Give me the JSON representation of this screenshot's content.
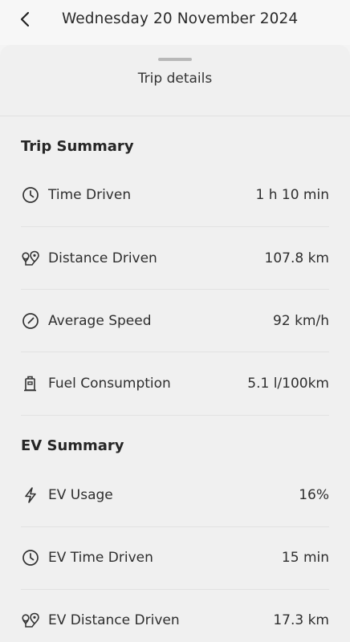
{
  "header": {
    "date": "Wednesday 20 November 2024",
    "back_icon": "chevron-left-icon"
  },
  "sheet": {
    "title": "Trip details"
  },
  "trip_summary": {
    "title": "Trip Summary",
    "rows": [
      {
        "icon": "clock-icon",
        "label": "Time Driven",
        "value": "1 h 10 min"
      },
      {
        "icon": "route-pin-icon",
        "label": "Distance Driven",
        "value": "107.8 km"
      },
      {
        "icon": "speedometer-icon",
        "label": "Average Speed",
        "value": "92 km/h"
      },
      {
        "icon": "fuel-pump-icon",
        "label": "Fuel Consumption",
        "value": "5.1 l/100km"
      }
    ]
  },
  "ev_summary": {
    "title": "EV Summary",
    "rows": [
      {
        "icon": "lightning-icon",
        "label": "EV Usage",
        "value": "16%"
      },
      {
        "icon": "clock-icon",
        "label": "EV Time Driven",
        "value": "15 min"
      },
      {
        "icon": "route-pin-icon",
        "label": "EV Distance Driven",
        "value": "17.3 km"
      }
    ]
  }
}
